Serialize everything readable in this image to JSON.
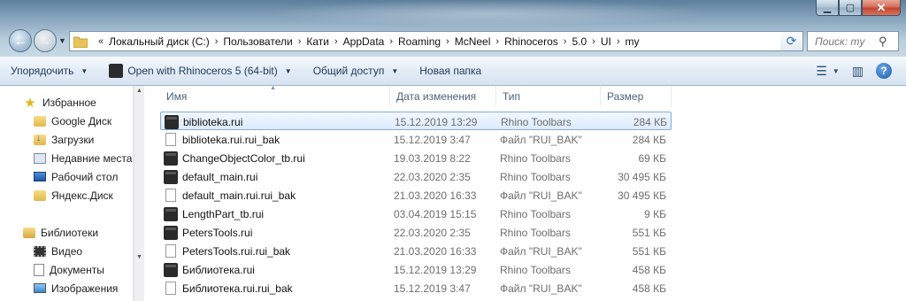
{
  "address": {
    "breadcrumbs": [
      "Локальный диск (C:)",
      "Пользователи",
      "Кати",
      "AppData",
      "Roaming",
      "McNeel",
      "Rhinoceros",
      "5.0",
      "UI",
      "my"
    ]
  },
  "search": {
    "placeholder": "Поиск: my"
  },
  "toolbar": {
    "organize": "Упорядочить",
    "open_with": "Open with Rhinoceros 5 (64-bit)",
    "share": "Общий доступ",
    "new_folder": "Новая папка"
  },
  "nav": {
    "favorites": "Избранное",
    "items": [
      "Google Диск",
      "Загрузки",
      "Недавние места",
      "Рабочий стол",
      "Яндекс.Диск"
    ],
    "libraries": "Библиотеки",
    "lib_items": [
      "Видео",
      "Документы",
      "Изображения"
    ]
  },
  "columns": {
    "name": "Имя",
    "date": "Дата изменения",
    "type": "Тип",
    "size": "Размер"
  },
  "files": [
    {
      "name": "biblioteka.rui",
      "date": "15.12.2019 13:29",
      "type": "Rhino Toolbars",
      "size": "284 КБ",
      "icon": "rui"
    },
    {
      "name": "biblioteka.rui.rui_bak",
      "date": "15.12.2019 3:47",
      "type": "Файл \"RUI_BAK\"",
      "size": "284 КБ",
      "icon": "bak"
    },
    {
      "name": "ChangeObjectColor_tb.rui",
      "date": "19.03.2019 8:22",
      "type": "Rhino Toolbars",
      "size": "69 КБ",
      "icon": "rui"
    },
    {
      "name": "default_main.rui",
      "date": "22.03.2020 2:35",
      "type": "Rhino Toolbars",
      "size": "30 495 КБ",
      "icon": "rui"
    },
    {
      "name": "default_main.rui.rui_bak",
      "date": "21.03.2020 16:33",
      "type": "Файл \"RUI_BAK\"",
      "size": "30 495 КБ",
      "icon": "bak"
    },
    {
      "name": "LengthPart_tb.rui",
      "date": "03.04.2019 15:15",
      "type": "Rhino Toolbars",
      "size": "9 КБ",
      "icon": "rui"
    },
    {
      "name": "PetersTools.rui",
      "date": "22.03.2020 2:35",
      "type": "Rhino Toolbars",
      "size": "551 КБ",
      "icon": "rui"
    },
    {
      "name": "PetersTools.rui.rui_bak",
      "date": "21.03.2020 16:33",
      "type": "Файл \"RUI_BAK\"",
      "size": "551 КБ",
      "icon": "bak"
    },
    {
      "name": "Библиотека.rui",
      "date": "15.12.2019 13:29",
      "type": "Rhino Toolbars",
      "size": "458 КБ",
      "icon": "rui"
    },
    {
      "name": "Библиотека.rui.rui_bak",
      "date": "15.12.2019 3:47",
      "type": "Файл \"RUI_BAK\"",
      "size": "458 КБ",
      "icon": "bak"
    }
  ],
  "selected_index": 0
}
